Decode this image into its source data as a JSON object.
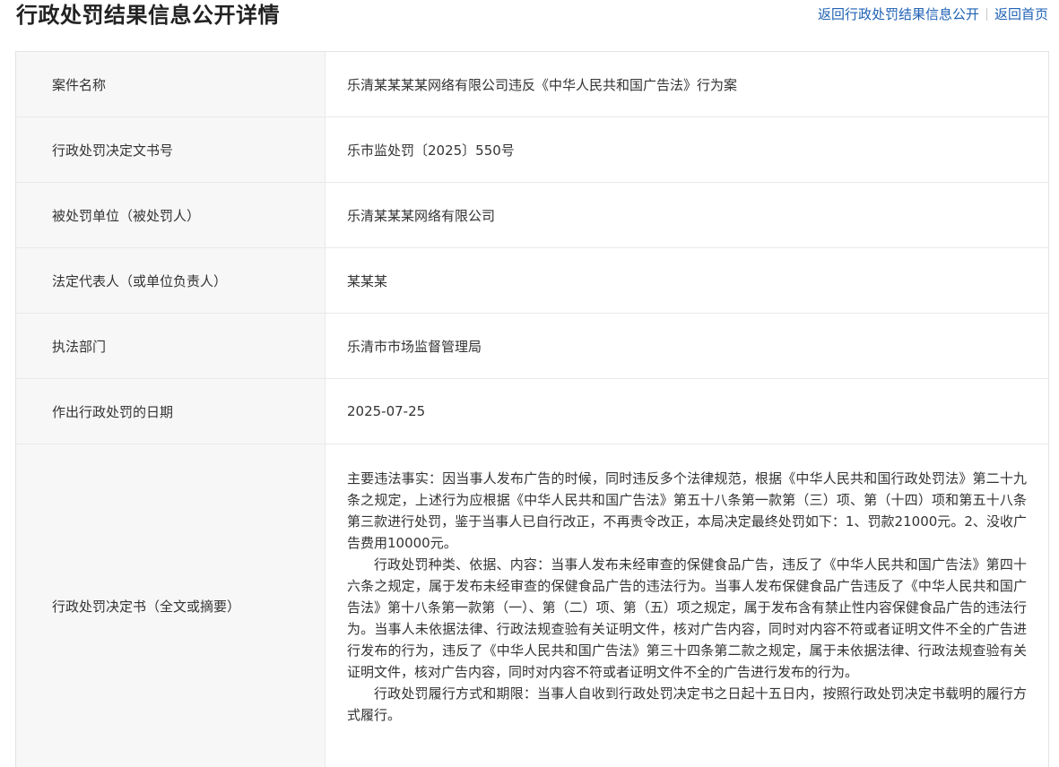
{
  "header": {
    "title": "行政处罚结果信息公开详情",
    "link_back_list": "返回行政处罚结果信息公开",
    "link_home": "返回首页"
  },
  "rows": [
    {
      "label": "案件名称",
      "value": "乐清某某某某网络有限公司违反《中华人民共和国广告法》行为案"
    },
    {
      "label": "行政处罚决定文书号",
      "value": "乐市监处罚〔2025〕550号"
    },
    {
      "label": "被处罚单位（被处罚人）",
      "value": "乐清某某某网络有限公司"
    },
    {
      "label": "法定代表人（或单位负责人）",
      "value": "某某某"
    },
    {
      "label": "执法部门",
      "value": "乐清市市场监督管理局"
    },
    {
      "label": "作出行政处罚的日期",
      "value": "2025-07-25"
    }
  ],
  "decision": {
    "label": "行政处罚决定书（全文或摘要）",
    "paragraphs": [
      "主要违法事实：因当事人发布广告的时候，同时违反多个法律规范，根据《中华人民共和国行政处罚法》第二十九条之规定，上述行为应根据《中华人民共和国广告法》第五十八条第一款第（三）项、第（十四）项和第五十八条第三款进行处罚，鉴于当事人已自行改正，不再责令改正，本局决定最终处罚如下：1、罚款21000元。2、没收广告费用10000元。",
      "行政处罚种类、依据、内容：当事人发布未经审查的保健食品广告，违反了《中华人民共和国广告法》第四十六条之规定，属于发布未经审查的保健食品广告的违法行为。当事人发布保健食品广告违反了《中华人民共和国广告法》第十八条第一款第（一）、第（二）项、第（五）项之规定，属于发布含有禁止性内容保健食品广告的违法行为。当事人未依据法律、行政法规查验有关证明文件，核对广告内容，同时对内容不符或者证明文件不全的广告进行发布的行为，违反了《中华人民共和国广告法》第三十四条第二款之规定，属于未依据法律、行政法规查验有关证明文件，核对广告内容，同时对内容不符或者证明文件不全的广告进行发布的行为。",
      "行政处罚履行方式和期限：当事人自收到行政处罚决定书之日起十五日内，按照行政处罚决定书载明的履行方式履行。"
    ]
  }
}
